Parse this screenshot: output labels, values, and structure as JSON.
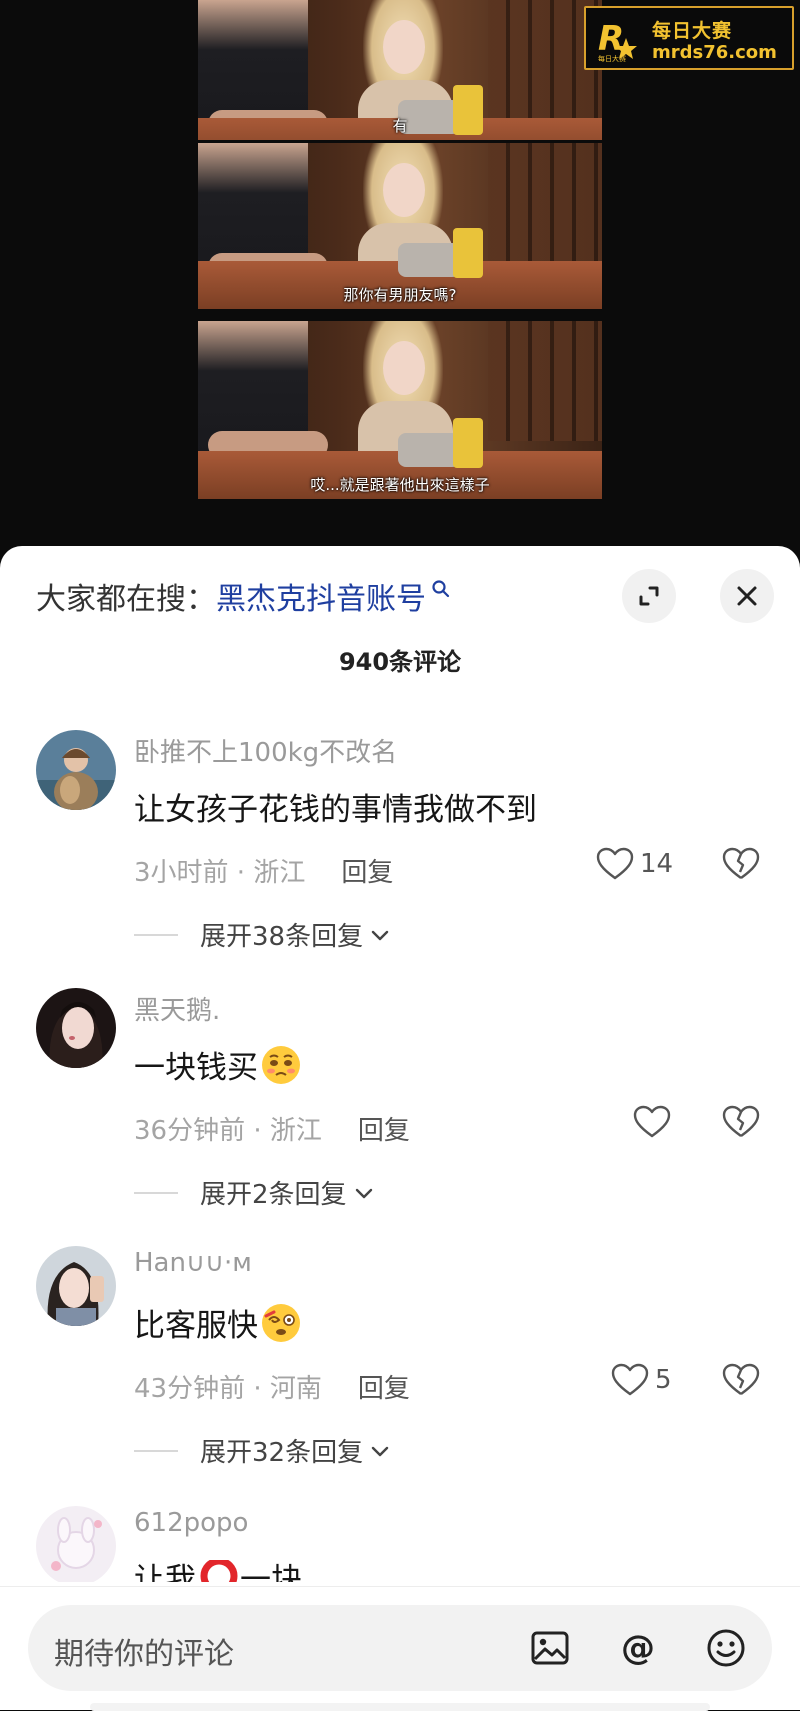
{
  "video": {
    "subtitles": [
      "有",
      "那你有男朋友嗎?",
      "哎...就是跟著他出來這樣子"
    ]
  },
  "watermark": {
    "title": "每日大赛",
    "url": "mrds76.com",
    "sub": "每日大赛"
  },
  "sheet": {
    "search_prefix": "大家都在搜：",
    "search_keyword": "黑杰克抖音账号",
    "comment_count_title": "940条评论"
  },
  "comments": [
    {
      "user": "卧推不上100kg不改名",
      "text": "让女孩子花钱的事情我做不到",
      "meta": "3小时前 · 浙江",
      "reply_label": "回复",
      "likes": "14",
      "expand": "展开38条回复"
    },
    {
      "user": "黑天鹅.",
      "text": "一块钱买",
      "emoji": "pleading-face-emoji",
      "meta": "36分钟前 · 浙江",
      "reply_label": "回复",
      "likes": "",
      "expand": "展开2条回复"
    },
    {
      "user": "Han∪∪·ᴍ",
      "text": "比客服快",
      "emoji": "dizzy-face-emoji",
      "meta": "43分钟前 · 河南",
      "reply_label": "回复",
      "likes": "5",
      "expand": "展开32条回复"
    },
    {
      "user": "612popo",
      "text": "让我",
      "text_after": "一块",
      "emoji": "red-circle-emoji"
    }
  ],
  "input": {
    "placeholder": "期待你的评论"
  },
  "colors": {
    "keyword_blue": "#1f3fa0",
    "watermark_gold": "#f2c230",
    "sheet_bg": "#ffffff"
  }
}
